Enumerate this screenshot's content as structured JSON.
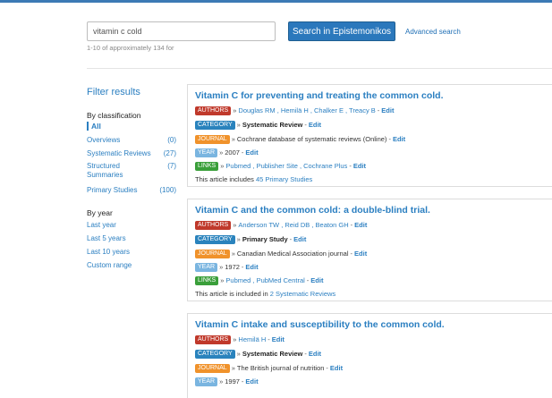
{
  "search": {
    "value": "vitamin c cold",
    "button_label": "Search in Epistemonikos",
    "advanced_label": "Advanced search",
    "result_count": "1-10 of approximately 134 for"
  },
  "filters": {
    "title": "Filter results",
    "by_classification_label": "By classification",
    "all_label": "All",
    "classifications": [
      {
        "name": "Overviews",
        "count": "(0)"
      },
      {
        "name": "Systematic Reviews",
        "count": "(27)"
      },
      {
        "name": "Structured Summaries",
        "count": "(7)"
      },
      {
        "name": "Primary Studies",
        "count": "(100)"
      }
    ],
    "by_year_label": "By year",
    "years": [
      "Last year",
      "Last 5 years",
      "Last 10 years",
      "Custom range"
    ]
  },
  "tags": {
    "authors": "AUTHORS",
    "category": "CATEGORY",
    "journal": "JOURNAL",
    "year": "YEAR",
    "links": "LINKS"
  },
  "common": {
    "sep": "»",
    "edit": "Edit",
    "dash": "-"
  },
  "results": [
    {
      "title": "Vitamin C for preventing and treating the common cold.",
      "authors": "Douglas RM , Hemilä H , Chalker E , Treacy B",
      "category": "Systematic Review",
      "journal": "Cochrane database of systematic reviews (Online)",
      "year": "2007",
      "links": "Pubmed , Publisher Site , Cochrane Plus",
      "note_prefix": "This article includes ",
      "note_link": "45 Primary Studies"
    },
    {
      "title": "Vitamin C and the common cold: a double-blind trial.",
      "authors": "Anderson TW , Reid DB , Beaton GH",
      "category": "Primary Study",
      "journal": "Canadian Medical Association journal",
      "year": "1972",
      "links": "Pubmed , PubMed Central",
      "note_prefix": "This article is included in ",
      "note_link": "2 Systematic Reviews"
    },
    {
      "title": "Vitamin C intake and susceptibility to the common cold.",
      "authors": "Hemilä H",
      "category": "Systematic Review",
      "journal": "The British journal of nutrition",
      "year": "1997"
    }
  ]
}
